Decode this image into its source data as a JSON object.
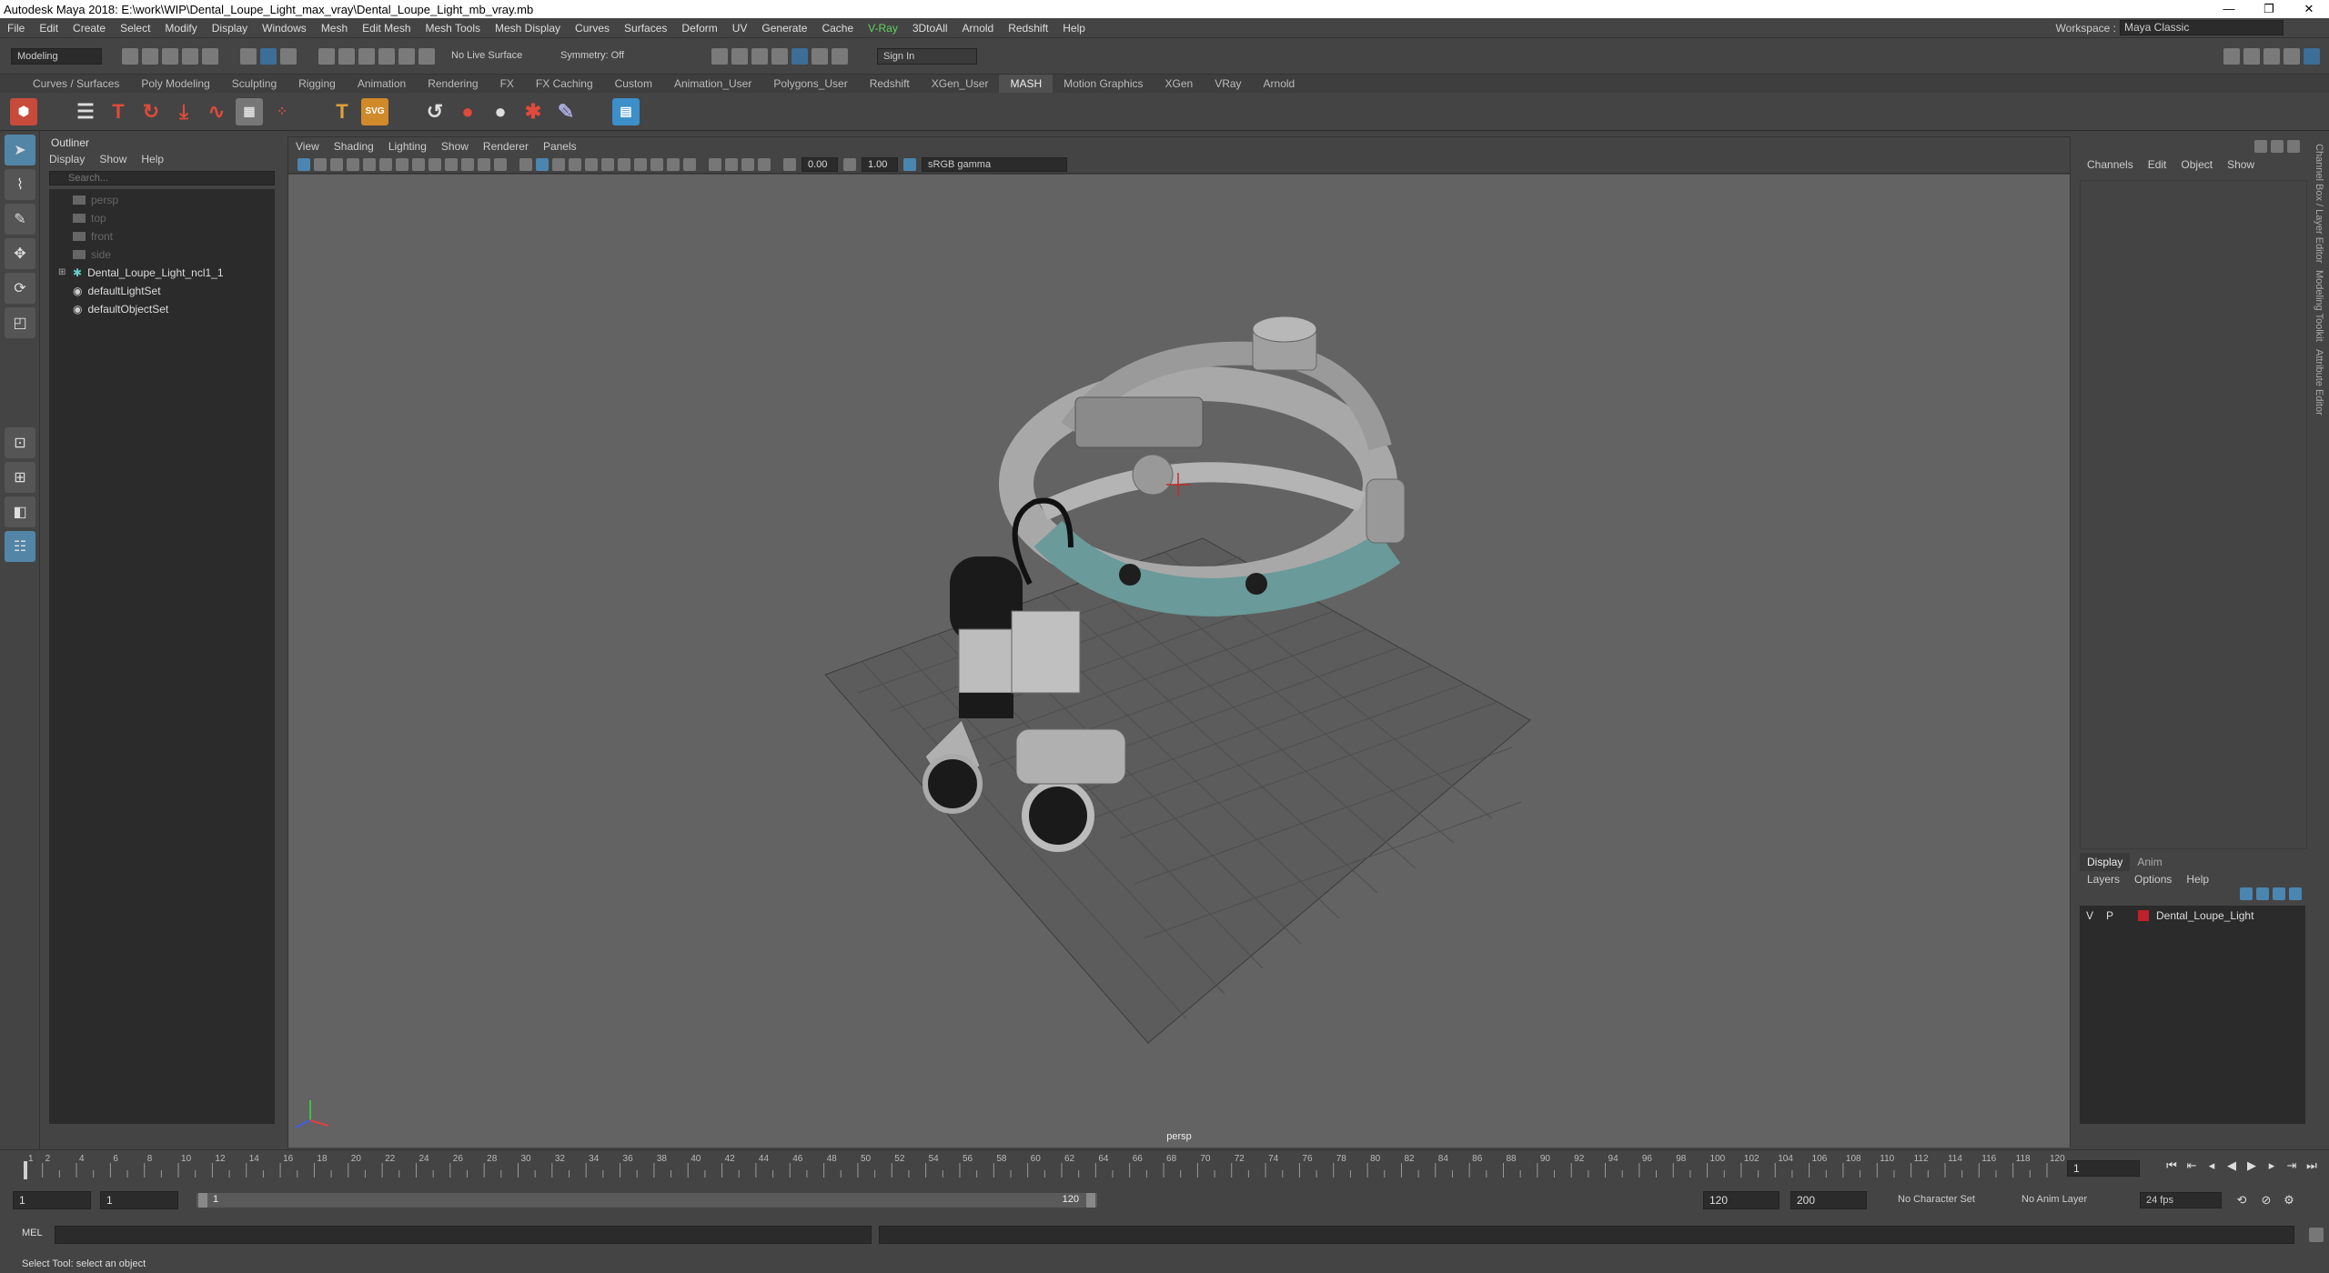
{
  "window": {
    "title": "Autodesk Maya 2018: E:\\work\\WIP\\Dental_Loupe_Light_max_vray\\Dental_Loupe_Light_mb_vray.mb"
  },
  "menubar": {
    "items": [
      "File",
      "Edit",
      "Create",
      "Select",
      "Modify",
      "Display",
      "Windows",
      "Mesh",
      "Edit Mesh",
      "Mesh Tools",
      "Mesh Display",
      "Curves",
      "Surfaces",
      "Deform",
      "UV",
      "Generate",
      "Cache",
      "V-Ray",
      "3DtoAll",
      "Arnold",
      "Redshift",
      "Help"
    ]
  },
  "workspace": {
    "label": "Workspace :",
    "value": "Maya Classic"
  },
  "statusline": {
    "mode": "Modeling",
    "live_surface": "No Live Surface",
    "symmetry": "Symmetry: Off",
    "sign_in": "Sign In"
  },
  "shelf": {
    "tabs": [
      "Curves / Surfaces",
      "Poly Modeling",
      "Sculpting",
      "Rigging",
      "Animation",
      "Rendering",
      "FX",
      "FX Caching",
      "Custom",
      "Animation_User",
      "Polygons_User",
      "Redshift",
      "XGen_User",
      "MASH",
      "Motion Graphics",
      "XGen",
      "VRay",
      "Arnold"
    ],
    "active_tab": "MASH"
  },
  "outliner": {
    "title": "Outliner",
    "menu": [
      "Display",
      "Show",
      "Help"
    ],
    "search_placeholder": "Search...",
    "items": [
      {
        "label": "persp",
        "dim": true
      },
      {
        "label": "top",
        "dim": true
      },
      {
        "label": "front",
        "dim": true
      },
      {
        "label": "side",
        "dim": true
      },
      {
        "label": "Dental_Loupe_Light_ncl1_1",
        "dim": false
      },
      {
        "label": "defaultLightSet",
        "dim": false
      },
      {
        "label": "defaultObjectSet",
        "dim": false
      }
    ]
  },
  "viewport": {
    "menu": [
      "View",
      "Shading",
      "Lighting",
      "Show",
      "Renderer",
      "Panels"
    ],
    "exposure": "0.00",
    "gamma": "1.00",
    "color_space": "sRGB gamma",
    "camera_label": "persp"
  },
  "channelbox": {
    "menu": [
      "Channels",
      "Edit",
      "Object",
      "Show"
    ],
    "layer_tabs": [
      "Display",
      "Anim"
    ],
    "layer_menu": [
      "Layers",
      "Options",
      "Help"
    ],
    "layers": [
      {
        "v": "V",
        "p": "P",
        "name": "Dental_Loupe_Light",
        "color": "#c0202a"
      }
    ]
  },
  "sidetabs": [
    "Channel Box / Layer Editor",
    "Modeling Toolkit",
    "Attribute Editor"
  ],
  "timeline": {
    "ticks": [
      "1",
      "2",
      "4",
      "6",
      "8",
      "10",
      "12",
      "14",
      "16",
      "18",
      "20",
      "22",
      "24",
      "26",
      "28",
      "30",
      "32",
      "34",
      "36",
      "38",
      "40",
      "42",
      "44",
      "46",
      "48",
      "50",
      "52",
      "54",
      "56",
      "58",
      "60",
      "62",
      "64",
      "66",
      "68",
      "70",
      "72",
      "74",
      "76",
      "78",
      "80",
      "82",
      "84",
      "86",
      "88",
      "90",
      "92",
      "94",
      "96",
      "98",
      "100",
      "102",
      "104",
      "106",
      "108",
      "110",
      "112",
      "114",
      "116",
      "118",
      "120"
    ],
    "current_frame": "1"
  },
  "range": {
    "start": "1",
    "anim_start": "1",
    "range_start_label": "1",
    "range_end_label": "120",
    "end": "120",
    "anim_end": "200",
    "character_set": "No Character Set",
    "anim_layer": "No Anim Layer",
    "fps": "24 fps"
  },
  "cmdline": {
    "label": "MEL"
  },
  "helpline": {
    "text": "Select Tool: select an object"
  }
}
